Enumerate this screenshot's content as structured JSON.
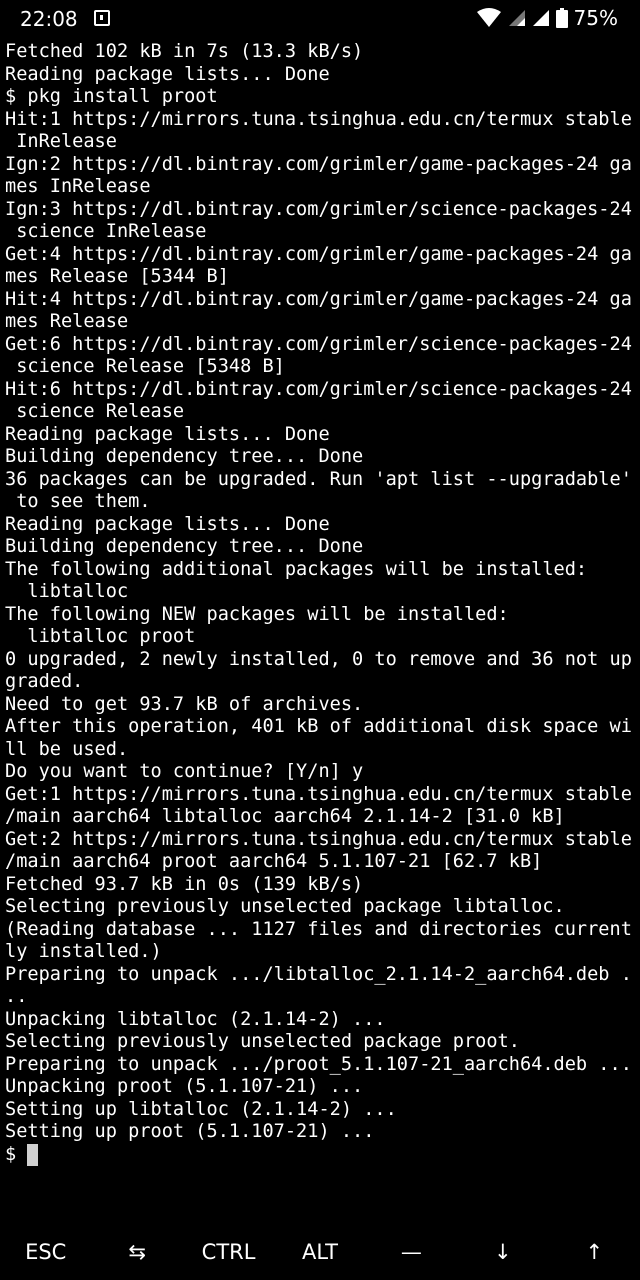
{
  "status_bar": {
    "time": "22:08",
    "battery": "75%",
    "icons": [
      "notification-icon",
      "wifi-icon",
      "signal-icon",
      "signal-icon",
      "battery-icon"
    ]
  },
  "terminal": {
    "lines": [
      "Fetched 102 kB in 7s (13.3 kB/s)",
      "Reading package lists... Done",
      "$ pkg install proot",
      "Hit:1 https://mirrors.tuna.tsinghua.edu.cn/termux stable",
      " InRelease",
      "Ign:2 https://dl.bintray.com/grimler/game-packages-24 ga",
      "mes InRelease",
      "Ign:3 https://dl.bintray.com/grimler/science-packages-24",
      " science InRelease",
      "Get:4 https://dl.bintray.com/grimler/game-packages-24 ga",
      "mes Release [5344 B]",
      "Hit:4 https://dl.bintray.com/grimler/game-packages-24 ga",
      "mes Release",
      "Get:6 https://dl.bintray.com/grimler/science-packages-24",
      " science Release [5348 B]",
      "Hit:6 https://dl.bintray.com/grimler/science-packages-24",
      " science Release",
      "Reading package lists... Done",
      "Building dependency tree... Done",
      "36 packages can be upgraded. Run 'apt list --upgradable'",
      " to see them.",
      "Reading package lists... Done",
      "Building dependency tree... Done",
      "The following additional packages will be installed:",
      "  libtalloc",
      "The following NEW packages will be installed:",
      "  libtalloc proot",
      "0 upgraded, 2 newly installed, 0 to remove and 36 not up",
      "graded.",
      "Need to get 93.7 kB of archives.",
      "After this operation, 401 kB of additional disk space wi",
      "ll be used.",
      "Do you want to continue? [Y/n] y",
      "Get:1 https://mirrors.tuna.tsinghua.edu.cn/termux stable",
      "/main aarch64 libtalloc aarch64 2.1.14-2 [31.0 kB]",
      "Get:2 https://mirrors.tuna.tsinghua.edu.cn/termux stable",
      "/main aarch64 proot aarch64 5.1.107-21 [62.7 kB]",
      "Fetched 93.7 kB in 0s (139 kB/s)",
      "Selecting previously unselected package libtalloc.",
      "(Reading database ... 1127 files and directories current",
      "ly installed.)",
      "Preparing to unpack .../libtalloc_2.1.14-2_aarch64.deb .",
      "..",
      "Unpacking libtalloc (2.1.14-2) ...",
      "Selecting previously unselected package proot.",
      "Preparing to unpack .../proot_5.1.107-21_aarch64.deb ...",
      "Unpacking proot (5.1.107-21) ...",
      "Setting up libtalloc (2.1.14-2) ...",
      "Setting up proot (5.1.107-21) ..."
    ],
    "prompt": "$"
  },
  "extra_keys": [
    {
      "name": "esc-key",
      "label": "ESC"
    },
    {
      "name": "tab-key",
      "label": "⇆"
    },
    {
      "name": "ctrl-key",
      "label": "CTRL"
    },
    {
      "name": "alt-key",
      "label": "ALT"
    },
    {
      "name": "dash-key",
      "label": "—"
    },
    {
      "name": "arrow-down-key",
      "label": "↓"
    },
    {
      "name": "arrow-up-key",
      "label": "↑"
    }
  ]
}
